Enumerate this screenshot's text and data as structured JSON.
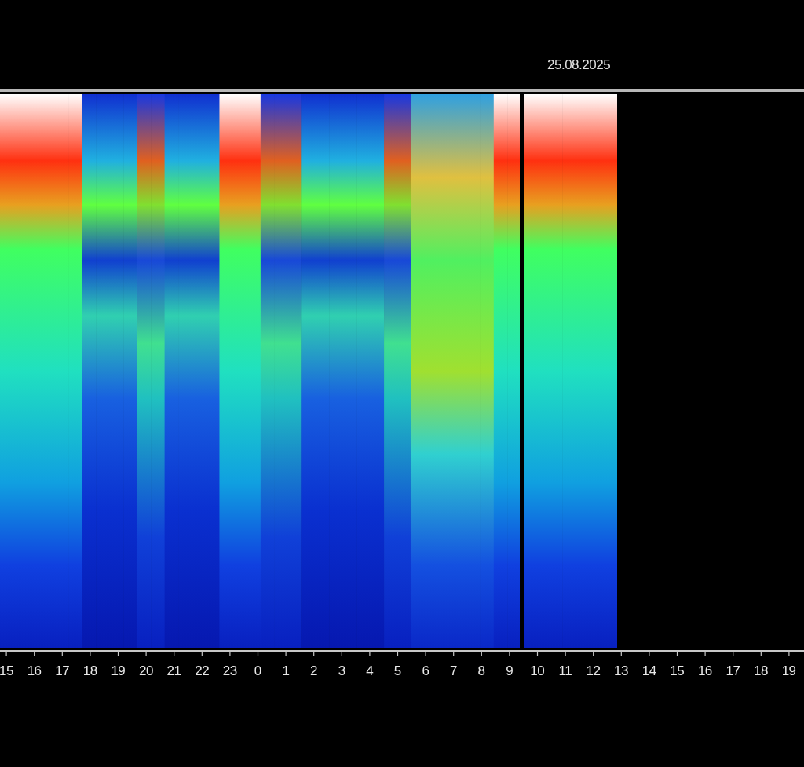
{
  "date": "25.08.2025",
  "hours": [
    "15",
    "16",
    "17",
    "18",
    "19",
    "20",
    "21",
    "22",
    "23",
    "0",
    "1",
    "2",
    "3",
    "4",
    "5",
    "6",
    "7",
    "8",
    "9",
    "10",
    "11",
    "12",
    "13",
    "14",
    "15",
    "16",
    "17",
    "18",
    "19"
  ]
}
